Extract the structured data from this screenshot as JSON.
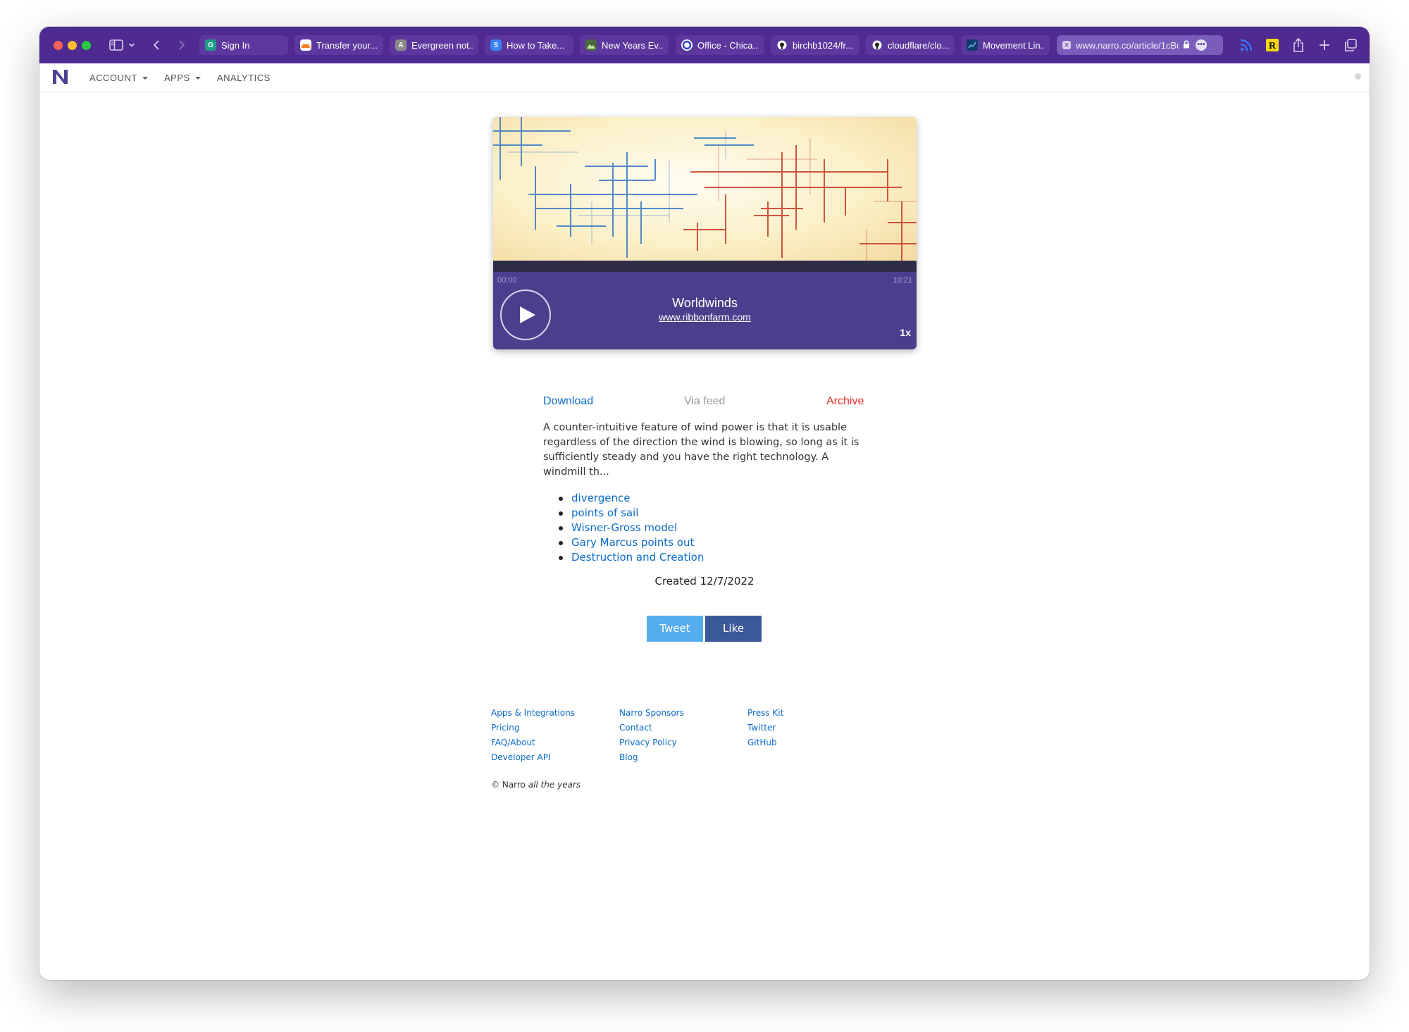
{
  "browser": {
    "tabs": [
      {
        "title": "Sign In",
        "favicon": "grammarly-g-icon",
        "color": "#1f9c85"
      },
      {
        "title": "Transfer your...",
        "favicon": "cloudflare-cloud-icon",
        "color": "#f48120"
      },
      {
        "title": "Evergreen not...",
        "favicon": "letter-a-icon",
        "color": "#8a8a8a"
      },
      {
        "title": "How to Take...",
        "favicon": "letter-s-icon",
        "color": "#3b82f6"
      },
      {
        "title": "New Years Ev...",
        "favicon": "photo-icon",
        "color": "#4b6a3a"
      },
      {
        "title": "Office - Chica...",
        "favicon": "o-ring-icon",
        "color": "#2e3fd6"
      },
      {
        "title": "birchb1024/fr...",
        "favicon": "github-icon",
        "color": "#222222"
      },
      {
        "title": "cloudflare/clo...",
        "favicon": "github-icon",
        "color": "#222222"
      },
      {
        "title": "Movement Lin...",
        "favicon": "chart-icon",
        "color": "#123a6b"
      }
    ],
    "active_tab": {
      "url": "www.narro.co/article/1cBc",
      "favicon": "close-x-icon"
    }
  },
  "site_nav": {
    "logo": "N",
    "items": [
      {
        "label": "ACCOUNT",
        "dropdown": true
      },
      {
        "label": "APPS",
        "dropdown": true
      },
      {
        "label": "ANALYTICS",
        "dropdown": false
      }
    ]
  },
  "player": {
    "current_time": "00:00",
    "duration": "10:21",
    "title": "Worldwinds",
    "source": "www.ribbonfarm.com",
    "speed": "1x",
    "progress": 0
  },
  "article": {
    "download_label": "Download",
    "via_label": "Via feed",
    "archive_label": "Archive",
    "excerpt": "A counter-intuitive feature of wind power is that it is usable regardless of the direction the wind is blowing, so long as it is sufficiently steady and you have the right technology. A windmill th...",
    "tags": [
      "divergence",
      "points of sail",
      "Wisner-Gross model",
      "Gary Marcus points out",
      "Destruction and Creation"
    ],
    "created": "Created 12/7/2022",
    "tweet_label": "Tweet",
    "like_label": "Like"
  },
  "footer": {
    "col1": [
      "Apps & Integrations",
      "Pricing",
      "FAQ/About",
      "Developer API"
    ],
    "col2": [
      "Narro Sponsors",
      "Contact",
      "Privacy Policy",
      "Blog"
    ],
    "col3": [
      "Press Kit",
      "Twitter",
      "GitHub"
    ],
    "copyright_prefix": "© Narro",
    "copyright_suffix": "all the years"
  },
  "colors": {
    "browser_chrome": "#4e2a91",
    "player_bg": "#4b3f8d",
    "link_blue": "#0b6bc9",
    "archive_red": "#e8302a",
    "tweet_blue": "#55acee",
    "like_blue": "#3b5998"
  }
}
